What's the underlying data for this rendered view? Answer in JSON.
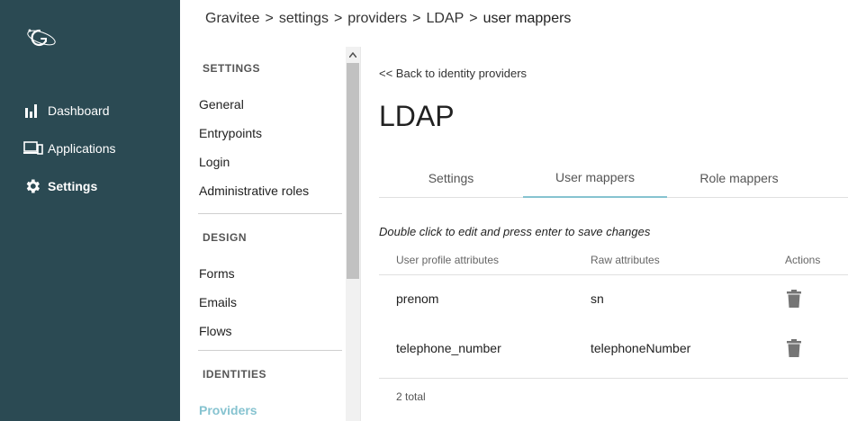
{
  "app": {
    "name": "Gravitee"
  },
  "breadcrumb": [
    "Gravitee",
    "settings",
    "providers",
    "LDAP",
    "user mappers"
  ],
  "breadcrumb_separator": ">",
  "nav": [
    {
      "label": "Dashboard",
      "icon": "bar-chart-icon",
      "active": false
    },
    {
      "label": "Applications",
      "icon": "devices-icon",
      "active": false
    },
    {
      "label": "Settings",
      "icon": "gear-icon",
      "active": true
    }
  ],
  "settings_menu": {
    "sections": [
      {
        "title": "SETTINGS",
        "items": [
          "General",
          "Entrypoints",
          "Login",
          "Administrative roles"
        ]
      },
      {
        "title": "DESIGN",
        "items": [
          "Forms",
          "Emails",
          "Flows"
        ]
      },
      {
        "title": "IDENTITIES",
        "items": [
          "Providers"
        ]
      }
    ],
    "active_item": "Providers"
  },
  "main": {
    "back_link": "<< Back to identity providers",
    "title": "LDAP",
    "tabs": [
      {
        "label": "Settings",
        "active": false
      },
      {
        "label": "User mappers",
        "active": true
      },
      {
        "label": "Role mappers",
        "active": false
      }
    ],
    "hint": "Double click to edit and press enter to save changes",
    "table": {
      "columns": [
        "User profile attributes",
        "Raw attributes",
        "Actions"
      ],
      "rows": [
        {
          "user_attr": "prenom",
          "raw_attr": "sn",
          "action_icon": "trash-icon"
        },
        {
          "user_attr": "telephone_number",
          "raw_attr": "telephoneNumber",
          "action_icon": "trash-icon"
        }
      ],
      "total": "2 total"
    }
  },
  "colors": {
    "sidenav_bg": "#2b4a53",
    "accent": "#86c3d0",
    "text": "#212121"
  }
}
